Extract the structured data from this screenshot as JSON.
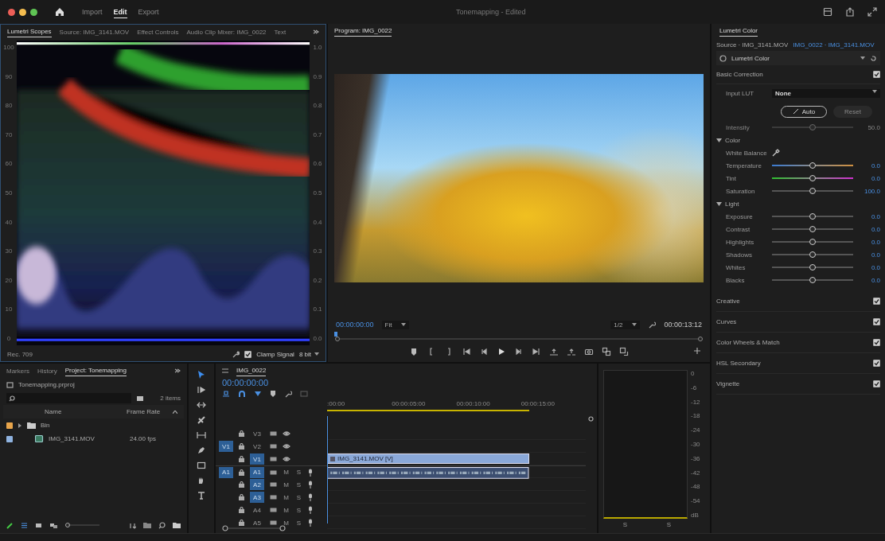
{
  "window": {
    "title": "Tonemapping - Edited"
  },
  "workspaces": [
    {
      "label": "Import",
      "selected": false
    },
    {
      "label": "Edit",
      "selected": true
    },
    {
      "label": "Export",
      "selected": false
    }
  ],
  "scopes": {
    "tabs": [
      {
        "label": "Lumetri Scopes",
        "selected": true
      },
      {
        "label": "Source: IMG_3141.MOV",
        "selected": false
      },
      {
        "label": "Effect Controls",
        "selected": false
      },
      {
        "label": "Audio Clip Mixer: IMG_0022",
        "selected": false
      },
      {
        "label": "Text",
        "selected": false
      }
    ],
    "left_scale": [
      "100",
      "90",
      "80",
      "70",
      "60",
      "50",
      "40",
      "30",
      "20",
      "10",
      "0"
    ],
    "right_scale": [
      "1.0",
      "0.9",
      "0.8",
      "0.7",
      "0.6",
      "0.5",
      "0.4",
      "0.3",
      "0.2",
      "0.1",
      "0.0"
    ],
    "color_space": "Rec. 709",
    "clamp_signal": {
      "label": "Clamp Signal",
      "checked": true
    },
    "bit_depth": "8 bit"
  },
  "program": {
    "tab": "Program: IMG_0022",
    "timecode": "00:00:00:00",
    "zoom": "Fit",
    "resolution": "1/2",
    "duration": "00:00:13:12"
  },
  "lumetri": {
    "tab": "Lumetri Color",
    "source": "Source · IMG_3141.MOV",
    "target": "IMG_0022 · IMG_3141.MOV",
    "effect": "Lumetri Color",
    "basic": {
      "title": "Basic Correction",
      "enabled": true,
      "lut_label": "Input LUT",
      "lut": "None",
      "auto": "Auto",
      "reset": {
        "label": "Reset",
        "disabled": true
      },
      "intensity": {
        "label": "Intensity",
        "value": "50.0",
        "level": 0.5,
        "disabled": true
      },
      "groups": [
        {
          "title": "Color",
          "expanded": true,
          "rows": [
            {
              "kind": "eyedropper",
              "label": "White Balance"
            },
            {
              "kind": "temperature-slider",
              "label": "Temperature",
              "value": "0.0",
              "level": 0.5
            },
            {
              "kind": "tint-slider",
              "label": "Tint",
              "value": "0.0",
              "level": 0.5
            },
            {
              "kind": "slider",
              "label": "Saturation",
              "value": "100.0",
              "level": 0.5
            }
          ]
        },
        {
          "title": "Light",
          "expanded": true,
          "rows": [
            {
              "kind": "slider",
              "label": "Exposure",
              "value": "0.0",
              "level": 0.5
            },
            {
              "kind": "slider",
              "label": "Contrast",
              "value": "0.0",
              "level": 0.5
            },
            {
              "kind": "slider",
              "label": "Highlights",
              "value": "0.0",
              "level": 0.5
            },
            {
              "kind": "slider",
              "label": "Shadows",
              "value": "0.0",
              "level": 0.5
            },
            {
              "kind": "slider",
              "label": "Whites",
              "value": "0.0",
              "level": 0.5
            },
            {
              "kind": "slider",
              "label": "Blacks",
              "value": "0.0",
              "level": 0.5
            }
          ]
        }
      ]
    },
    "sections": [
      {
        "title": "Creative",
        "enabled": true
      },
      {
        "title": "Curves",
        "enabled": true
      },
      {
        "title": "Color Wheels & Match",
        "enabled": true
      },
      {
        "title": "HSL Secondary",
        "enabled": true
      },
      {
        "title": "Vignette",
        "enabled": true
      }
    ]
  },
  "project": {
    "tabs": [
      {
        "label": "Markers",
        "selected": false
      },
      {
        "label": "History",
        "selected": false
      },
      {
        "label": "Project: Tonemapping",
        "selected": true
      }
    ],
    "file": "Tonemapping.prproj",
    "item_count": "2 items",
    "zoom": {
      "level": 0
    },
    "columns": [
      "Name",
      "Frame Rate"
    ],
    "rows": [
      {
        "kind": "bin",
        "name": "Bin",
        "color": "#e8a54b",
        "expanded": false
      },
      {
        "kind": "clip",
        "name": "IMG_3141.MOV",
        "frame_rate": "24.00 fps",
        "color": "#8fb3e0"
      }
    ]
  },
  "tools": [
    {
      "kind": "selection",
      "selected": true
    },
    {
      "kind": "track-select",
      "selected": false
    },
    {
      "kind": "ripple",
      "selected": false
    },
    {
      "kind": "razor",
      "selected": false
    },
    {
      "kind": "slip",
      "selected": false
    },
    {
      "kind": "pen",
      "selected": false
    },
    {
      "kind": "rectangle",
      "selected": false
    },
    {
      "kind": "hand",
      "selected": false
    },
    {
      "kind": "type",
      "selected": false
    }
  ],
  "timeline": {
    "tab": "IMG_0022",
    "timecode": "00:00:00:00",
    "ruler": [
      ":00:00",
      "00:00:05:00",
      "00:00:10:00",
      "00:00:15:00"
    ],
    "tracks": [
      {
        "kind": "video",
        "label": "V3",
        "targeted": false
      },
      {
        "kind": "video",
        "label": "V2",
        "targeted": false,
        "source": "V1"
      },
      {
        "kind": "video",
        "label": "V1",
        "targeted": true,
        "clip": {
          "kind": "video",
          "name": "IMG_3141.MOV [V]"
        }
      },
      {
        "kind": "audio",
        "label": "A1",
        "targeted": true,
        "source": "A1",
        "mute": "M",
        "solo": "S",
        "clip": {
          "kind": "audio"
        }
      },
      {
        "kind": "audio",
        "label": "A2",
        "targeted": true,
        "mute": "M",
        "solo": "S"
      },
      {
        "kind": "audio",
        "label": "A3",
        "targeted": true,
        "mute": "M",
        "solo": "S"
      },
      {
        "kind": "audio",
        "label": "A4",
        "targeted": false,
        "mute": "M",
        "solo": "S"
      },
      {
        "kind": "audio",
        "label": "A5",
        "targeted": false,
        "mute": "M",
        "solo": "S"
      }
    ]
  },
  "meter": {
    "scale": [
      "0",
      "-6",
      "-12",
      "-18",
      "-24",
      "-30",
      "-36",
      "-42",
      "-48",
      "-54",
      "dB"
    ],
    "solo_buttons": [
      "S",
      "S"
    ]
  }
}
